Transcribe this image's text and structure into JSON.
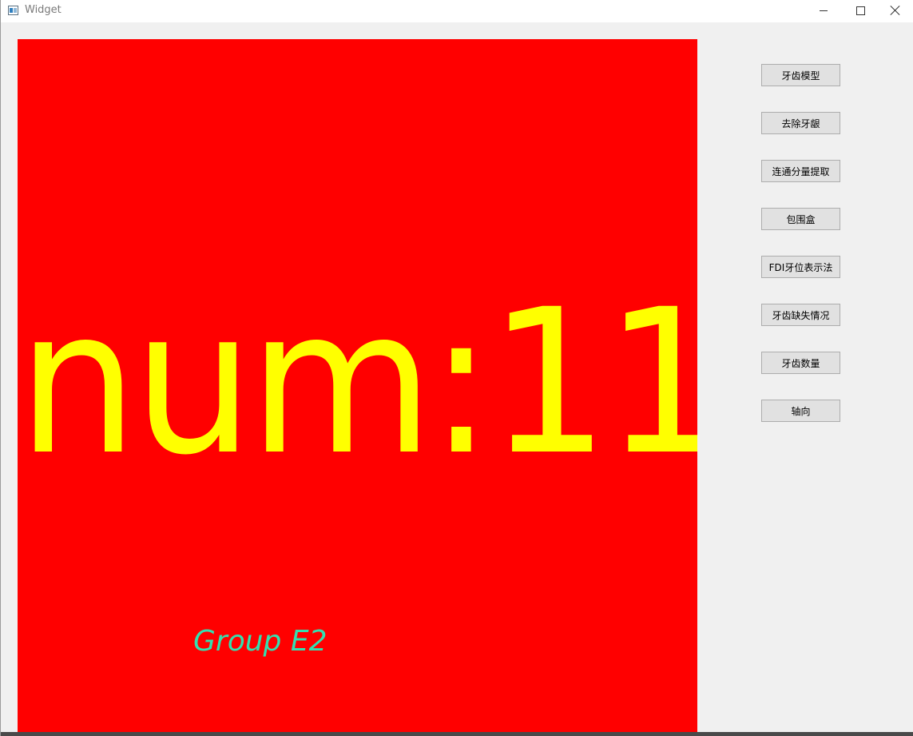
{
  "window": {
    "title": "Widget",
    "icons": {
      "app": "window-app-icon",
      "minimize": "minimize-icon",
      "maximize": "maximize-icon",
      "close": "close-icon"
    }
  },
  "canvas": {
    "background_color": "#ff0000",
    "count_text": "num:11",
    "count_color": "#ffff00",
    "group_text": "Group E2",
    "group_color": "#33e0b0"
  },
  "sidebar": {
    "buttons": [
      {
        "label": "牙齿模型"
      },
      {
        "label": "去除牙龈"
      },
      {
        "label": "连通分量提取"
      },
      {
        "label": "包围盒"
      },
      {
        "label": "FDI牙位表示法"
      },
      {
        "label": "牙齿缺失情况"
      },
      {
        "label": "牙齿数量"
      },
      {
        "label": "轴向"
      }
    ]
  }
}
